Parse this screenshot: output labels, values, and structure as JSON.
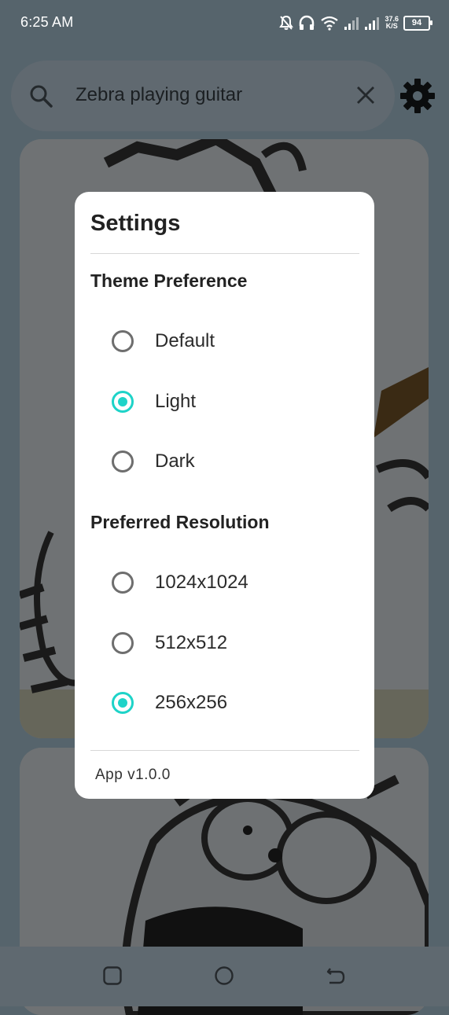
{
  "status_bar": {
    "time": "6:25 AM",
    "net_speed": "37.6",
    "net_unit": "K/S",
    "battery": "94"
  },
  "search": {
    "query": "Zebra playing guitar",
    "icon": "search-icon",
    "clear_icon": "close-icon"
  },
  "toolbar": {
    "settings_icon": "gear-icon"
  },
  "dialog": {
    "title": "Settings",
    "theme_section": {
      "title": "Theme Preference",
      "options": [
        {
          "label": "Default",
          "selected": false
        },
        {
          "label": "Light",
          "selected": true
        },
        {
          "label": "Dark",
          "selected": false
        }
      ]
    },
    "resolution_section": {
      "title": "Preferred Resolution",
      "options": [
        {
          "label": "1024x1024",
          "selected": false
        },
        {
          "label": "512x512",
          "selected": false
        },
        {
          "label": "256x256",
          "selected": true
        }
      ]
    },
    "version": "App v1.0.0"
  },
  "nav_bar": {
    "recents_icon": "square-icon",
    "home_icon": "circle-icon",
    "back_icon": "back-icon"
  },
  "colors": {
    "accent": "#1ed3c8",
    "scrim": "#56646c"
  }
}
